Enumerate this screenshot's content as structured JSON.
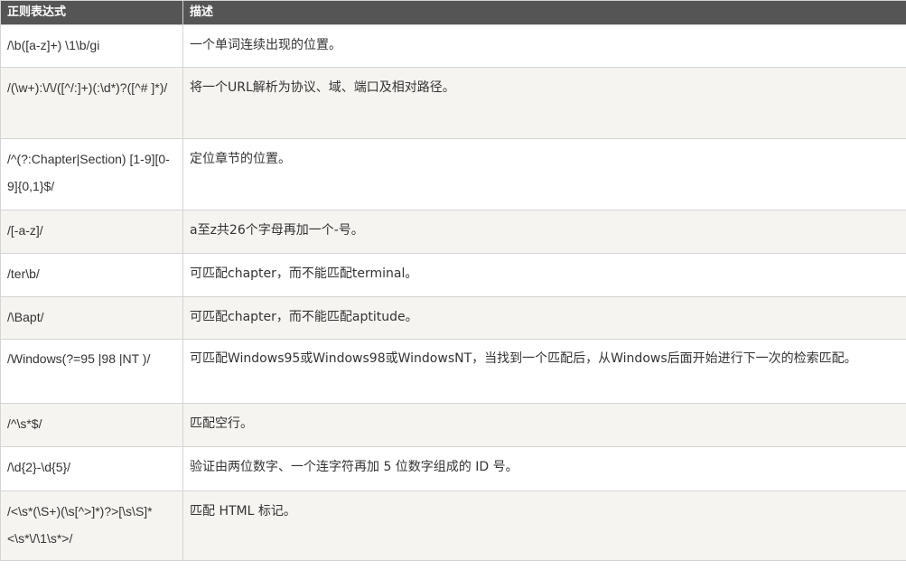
{
  "table": {
    "headers": [
      "正则表达式",
      "描述"
    ],
    "rows": [
      {
        "pattern": "/\\b([a-z]+) \\1\\b/gi",
        "description": "一个单词连续出现的位置。"
      },
      {
        "pattern": "/(\\w+):\\/\\/([^/:]+)(:\\d*)?([^# ]*)/",
        "description": "将一个URL解析为协议、域、端口及相对路径。"
      },
      {
        "pattern": "/^(?:Chapter|Section) [1-9][0-9]{0,1}$/",
        "description": "定位章节的位置。"
      },
      {
        "pattern": "/[-a-z]/",
        "description": "a至z共26个字母再加一个-号。"
      },
      {
        "pattern": "/ter\\b/",
        "description": "可匹配chapter，而不能匹配terminal。"
      },
      {
        "pattern": "/\\Bapt/",
        "description": "可匹配chapter，而不能匹配aptitude。"
      },
      {
        "pattern": "/Windows(?=95 |98 |NT )/",
        "description": "可匹配Windows95或Windows98或WindowsNT，当找到一个匹配后，从Windows后面开始进行下一次的检索匹配。"
      },
      {
        "pattern": "/^\\s*$/",
        "description": "匹配空行。"
      },
      {
        "pattern": "/\\d{2}-\\d{5}/",
        "description": "验证由两位数字、一个连字符再加 5 位数字组成的 ID 号。"
      },
      {
        "pattern": "/<\\s*(\\S+)(\\s[^>]*)?>[\\s\\S]*<\\s*\\/\\1\\s*>/",
        "description": "匹配 HTML 标记。"
      }
    ]
  }
}
